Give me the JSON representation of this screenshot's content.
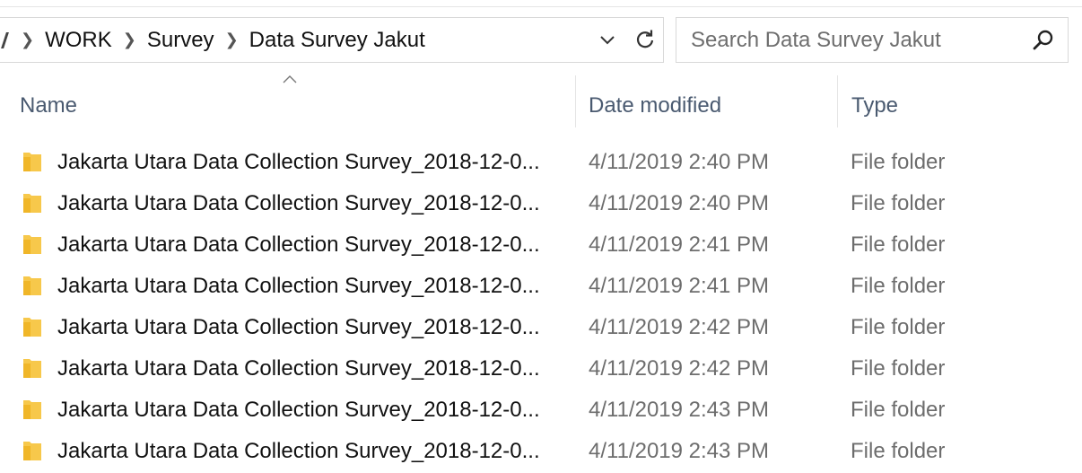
{
  "address": {
    "crumbs": [
      "WORK",
      "Survey",
      "Data Survey Jakut"
    ]
  },
  "search": {
    "placeholder": "Search Data Survey Jakut",
    "value": ""
  },
  "columns": {
    "name": "Name",
    "date": "Date modified",
    "type": "Type",
    "sorted_by": "Name",
    "sort_direction": "ascending"
  },
  "icons": {
    "folder": "folder-icon",
    "search": "search-icon",
    "refresh": "refresh-icon",
    "dropdown": "chevron-down-icon",
    "sort": "sort-up-icon"
  },
  "colors": {
    "folder": "#f7c84b",
    "header_text": "#4a5a70",
    "secondary_text": "#6d6d6d"
  },
  "files": [
    {
      "name": "Jakarta Utara Data Collection Survey_2018-12-0...",
      "date": "4/11/2019 2:40 PM",
      "type": "File folder"
    },
    {
      "name": "Jakarta Utara Data Collection Survey_2018-12-0...",
      "date": "4/11/2019 2:40 PM",
      "type": "File folder"
    },
    {
      "name": "Jakarta Utara Data Collection Survey_2018-12-0...",
      "date": "4/11/2019 2:41 PM",
      "type": "File folder"
    },
    {
      "name": "Jakarta Utara Data Collection Survey_2018-12-0...",
      "date": "4/11/2019 2:41 PM",
      "type": "File folder"
    },
    {
      "name": "Jakarta Utara Data Collection Survey_2018-12-0...",
      "date": "4/11/2019 2:42 PM",
      "type": "File folder"
    },
    {
      "name": "Jakarta Utara Data Collection Survey_2018-12-0...",
      "date": "4/11/2019 2:42 PM",
      "type": "File folder"
    },
    {
      "name": "Jakarta Utara Data Collection Survey_2018-12-0...",
      "date": "4/11/2019 2:43 PM",
      "type": "File folder"
    },
    {
      "name": "Jakarta Utara Data Collection Survey_2018-12-0...",
      "date": "4/11/2019 2:43 PM",
      "type": "File folder"
    }
  ]
}
